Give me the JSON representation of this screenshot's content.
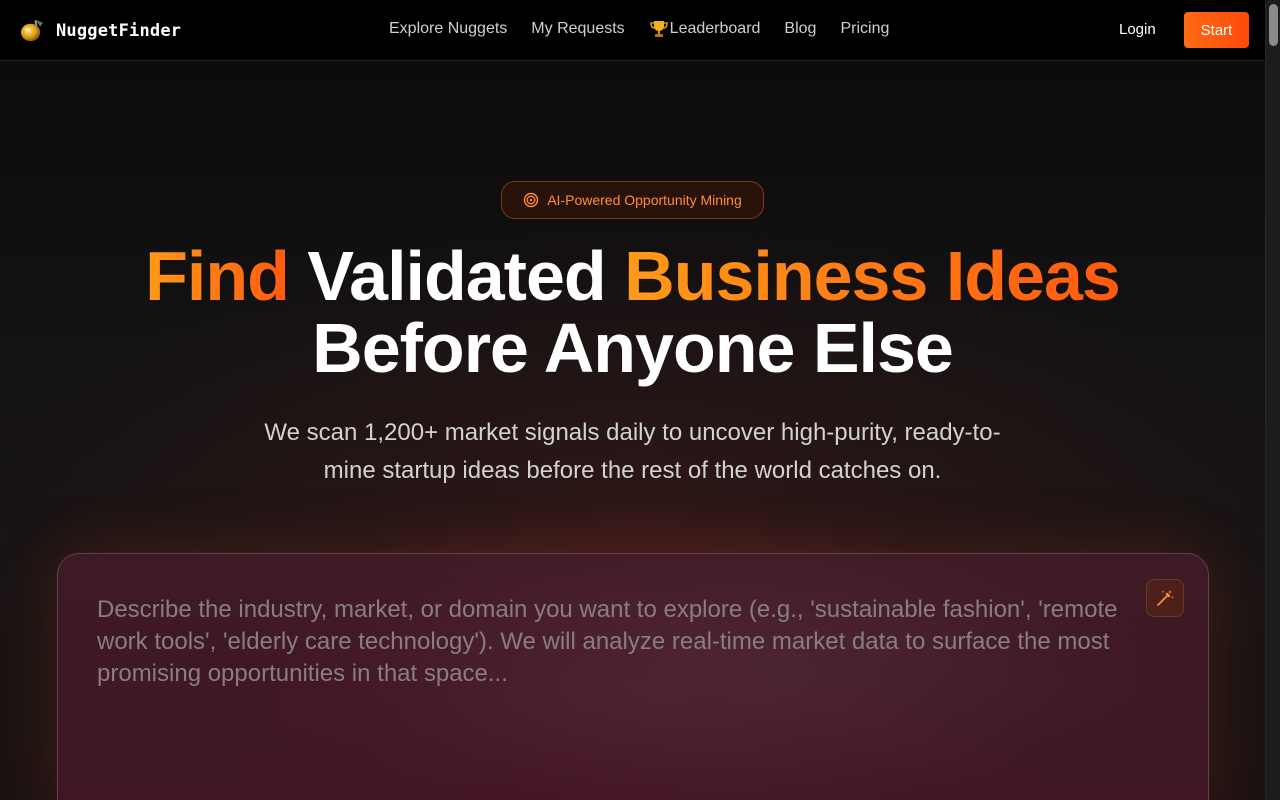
{
  "brand": {
    "name": "NuggetFinder",
    "icon": "gold-nugget-icon"
  },
  "nav": {
    "items": [
      {
        "label": "Explore Nuggets"
      },
      {
        "label": "My Requests"
      },
      {
        "label": "Leaderboard",
        "icon": "trophy-icon"
      },
      {
        "label": "Blog"
      },
      {
        "label": "Pricing"
      }
    ],
    "login_label": "Login",
    "start_label": "Start"
  },
  "hero": {
    "badge": "AI-Powered Opportunity Mining",
    "badge_icon": "target-icon",
    "headline": {
      "part1": "Find",
      "part2": " Validated ",
      "part3": "Business Ideas",
      "line2": "Before Anyone Else"
    },
    "subtitle": "We scan 1,200+ market signals daily to uncover high-purity, ready-to-mine startup ideas before the rest of the world catches on."
  },
  "prompt": {
    "placeholder": "Describe the industry, market, or domain you want to explore (e.g., 'sustainable fashion', 'remote work tools', 'elderly care technology'). We will analyze real-time market data to surface the most promising opportunities in that space...",
    "value": "",
    "action_icon": "magic-wand-icon"
  },
  "colors": {
    "accent": "#ff5a10",
    "accent_light": "#ff9a1a",
    "background": "#0a0a0a",
    "header": "#000000"
  }
}
